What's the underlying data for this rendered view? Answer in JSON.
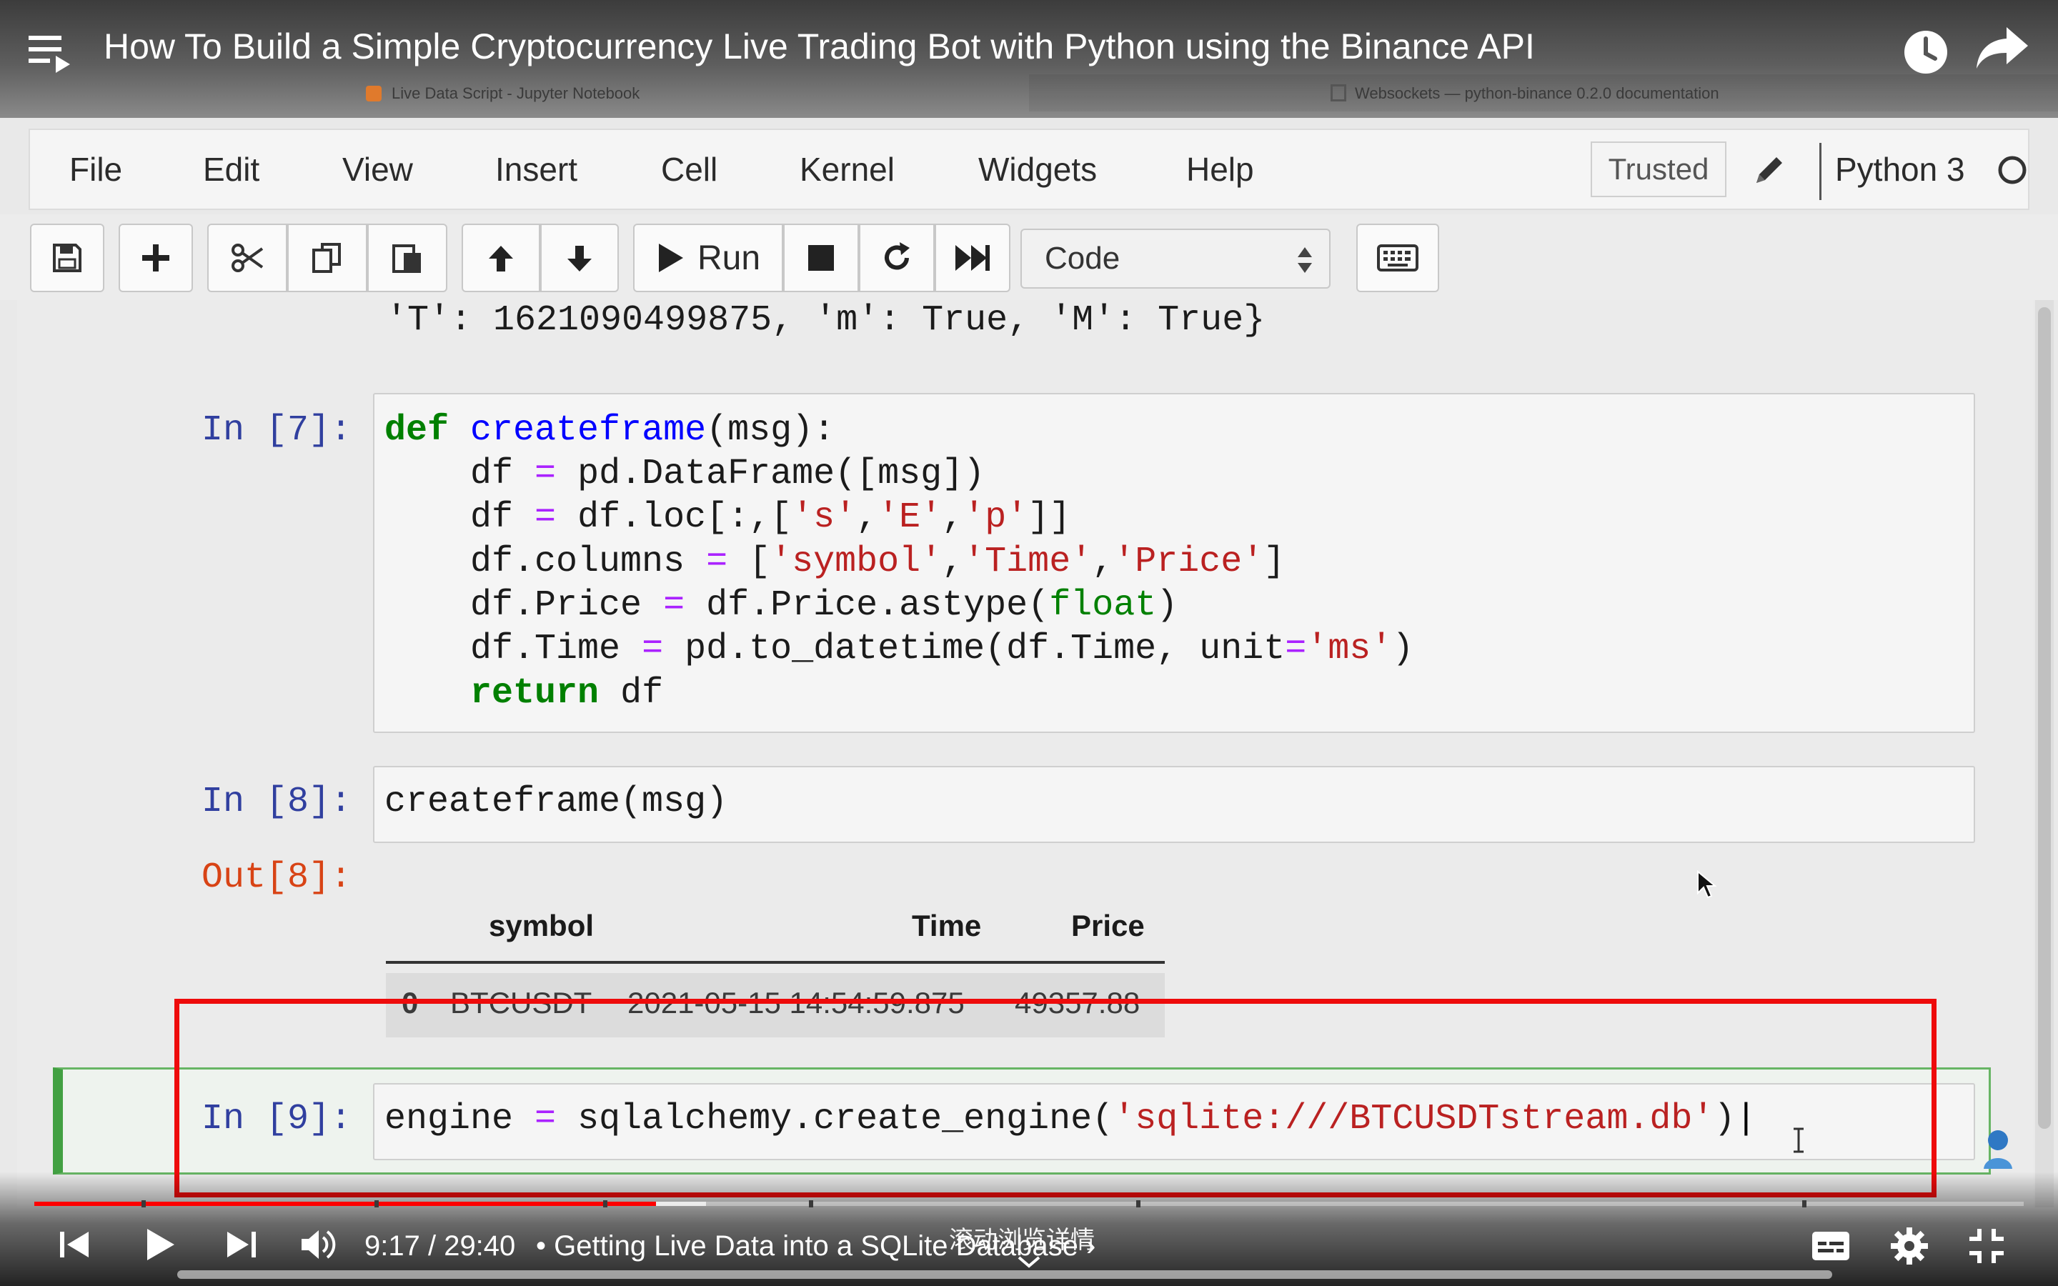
{
  "video": {
    "title": "How To Build a Simple Cryptocurrency Live Trading Bot with Python using the Binance API",
    "time_display": "9:17 / 29:40",
    "chapter": "• Getting Live Data into a SQLite Database ›",
    "overlay_hint": "滚动浏览详情",
    "progress_fraction": 0.3125
  },
  "browser": {
    "tab_left": "Live Data Script - Jupyter Notebook",
    "tab_right": "Websockets — python-binance 0.2.0 documentation"
  },
  "jupyter": {
    "menu": [
      "File",
      "Edit",
      "View",
      "Insert",
      "Cell",
      "Kernel",
      "Widgets",
      "Help"
    ],
    "trusted": "Trusted",
    "kernel": "Python 3",
    "toolbar": {
      "run_label": "Run",
      "cell_type": "Code"
    }
  },
  "cells": {
    "prev_output_tail": "'T': 1621090499875, 'm': True, 'M': True}",
    "cell7": {
      "prompt": "In [7]:",
      "lines": [
        "def createframe(msg):",
        "    df = pd.DataFrame([msg])",
        "    df = df.loc[:,['s','E','p']]",
        "    df.columns = ['symbol','Time','Price']",
        "    df.Price = df.Price.astype(float)",
        "    df.Time = pd.to_datetime(df.Time, unit='ms')",
        "    return df"
      ]
    },
    "cell8": {
      "prompt": "In [8]:",
      "code": "createframe(msg)",
      "out_prompt": "Out[8]:",
      "table": {
        "columns": [
          "symbol",
          "Time",
          "Price"
        ],
        "rows": [
          [
            "0",
            "BTCUSDT",
            "2021-05-15 14:54:59.875",
            "49357.88"
          ]
        ]
      }
    },
    "cell9": {
      "prompt": "In [9]:",
      "code": "engine = sqlalchemy.create_engine('sqlite:///BTCUSDTstream.db')"
    }
  },
  "colors": {
    "highlight_box": "#ee0b0b",
    "progress": "#ff0000",
    "active_cell": "#42a042"
  }
}
